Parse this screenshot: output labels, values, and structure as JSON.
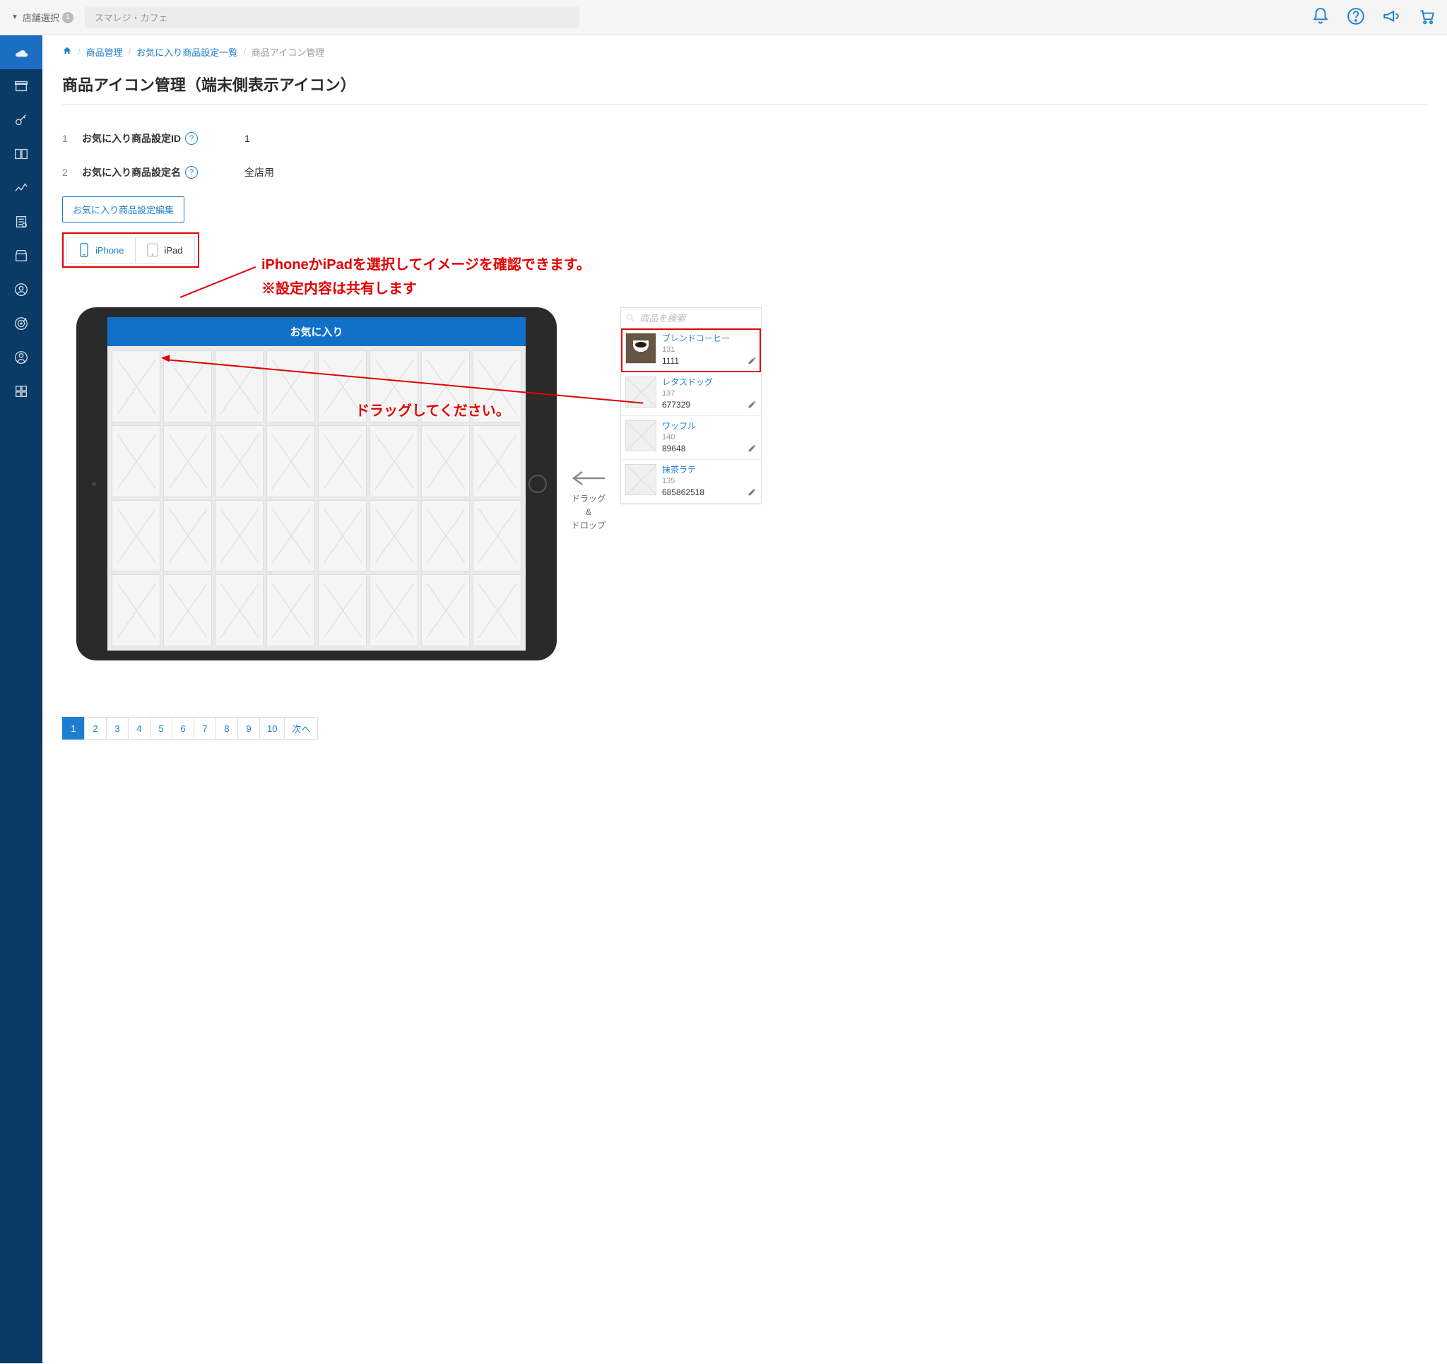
{
  "header": {
    "store_selector_label": "店舗選択",
    "store_badge": "1",
    "store_name": "スマレジ・カフェ"
  },
  "breadcrumb": {
    "items": [
      "商品管理",
      "お気に入り商品設定一覧",
      "商品アイコン管理"
    ]
  },
  "page_title": "商品アイコン管理（端末側表示アイコン）",
  "meta": {
    "rows": [
      {
        "num": "1",
        "label": "お気に入り商品設定ID",
        "value": "1"
      },
      {
        "num": "2",
        "label": "お気に入り商品設定名",
        "value": "全店用"
      }
    ]
  },
  "buttons": {
    "edit": "お気に入り商品設定編集"
  },
  "device_tabs": {
    "iphone": "iPhone",
    "ipad": "iPad"
  },
  "favorites_header": "お気に入り",
  "annotations": {
    "device_note_line1": "iPhoneかiPadを選択してイメージを確認できます。",
    "device_note_line2": "※設定内容は共有します",
    "drag_note": "ドラッグしてください。"
  },
  "drag_hint": {
    "line1": "ドラッグ",
    "line2": "&",
    "line3": "ドロップ"
  },
  "search": {
    "placeholder": "商品を検索"
  },
  "products": [
    {
      "name": "ブレンドコーヒー",
      "id": "131",
      "code": "1111",
      "highlighted": true,
      "has_image": true
    },
    {
      "name": "レタスドッグ",
      "id": "137",
      "code": "677329",
      "highlighted": false,
      "has_image": false
    },
    {
      "name": "ワッフル",
      "id": "140",
      "code": "89648",
      "highlighted": false,
      "has_image": false
    },
    {
      "name": "抹茶ラテ",
      "id": "135",
      "code": "685862518",
      "highlighted": false,
      "has_image": false
    }
  ],
  "pagination": {
    "pages": [
      "1",
      "2",
      "3",
      "4",
      "5",
      "6",
      "7",
      "8",
      "9",
      "10"
    ],
    "next": "次へ",
    "active": "1"
  }
}
